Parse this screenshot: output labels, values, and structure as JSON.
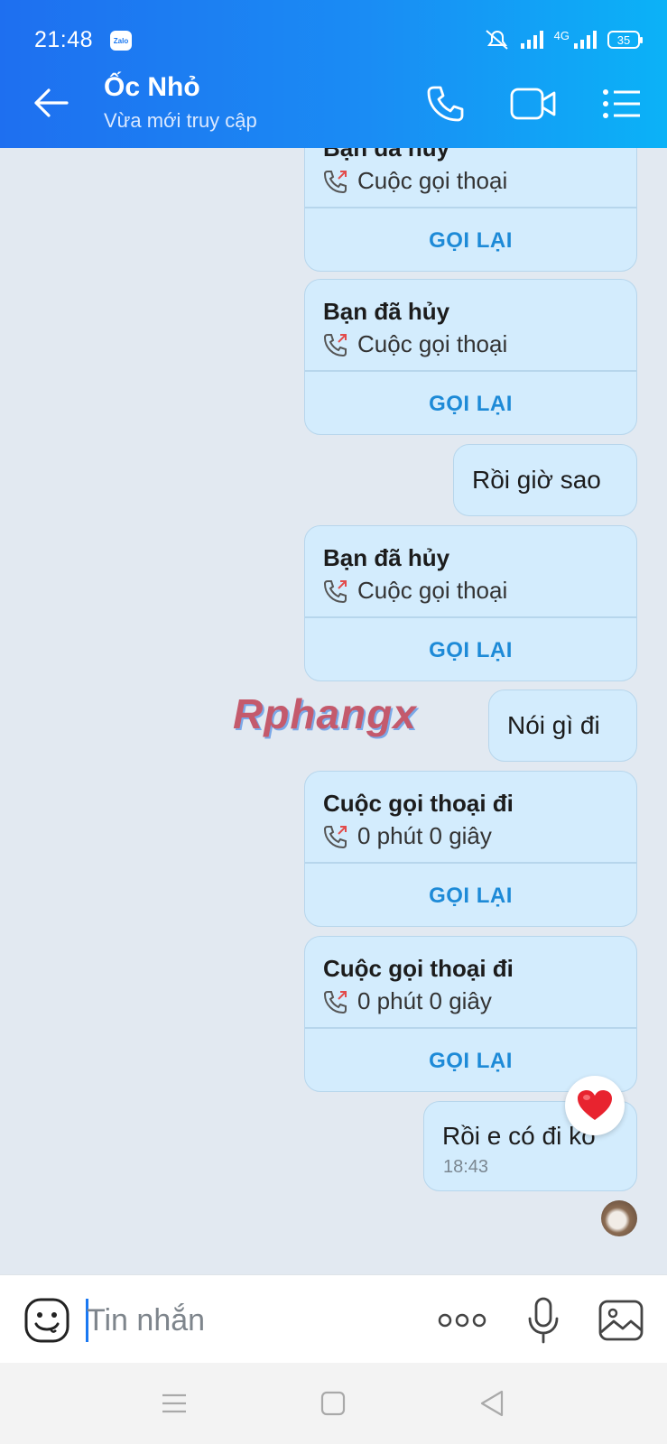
{
  "status_bar": {
    "time": "21:48",
    "app_badge": "Zalo",
    "network": "4G",
    "battery": "35"
  },
  "header": {
    "contact_name": "Ốc Nhỏ",
    "contact_status": "Vừa mới truy cập",
    "icons": [
      "back-arrow-icon",
      "phone-icon",
      "video-call-icon",
      "menu-list-icon"
    ]
  },
  "messages": [
    {
      "type": "call",
      "title": "Bạn đã hủy",
      "subtitle": "Cuộc gọi thoại",
      "action": "GỌI LẠI"
    },
    {
      "type": "call",
      "title": "Bạn đã hủy",
      "subtitle": "Cuộc gọi thoại",
      "action": "GỌI LẠI"
    },
    {
      "type": "text",
      "text": "Rồi giờ sao"
    },
    {
      "type": "call",
      "title": "Bạn đã hủy",
      "subtitle": "Cuộc gọi thoại",
      "action": "GỌI LẠI"
    },
    {
      "type": "text",
      "text": "Nói gì đi"
    },
    {
      "type": "call",
      "title": "Cuộc gọi thoại đi",
      "subtitle": "0 phút 0 giây",
      "action": "GỌI LẠI"
    },
    {
      "type": "call",
      "title": "Cuộc gọi thoại đi",
      "subtitle": "0 phút 0 giây",
      "action": "GỌI LẠI"
    },
    {
      "type": "text",
      "text": "Rồi e có đi ko",
      "time": "18:43",
      "reaction": "heart"
    }
  ],
  "watermark": "Rphangx",
  "input": {
    "placeholder": "Tin nhắn",
    "value": ""
  },
  "colors": {
    "header_start": "#1e6ff0",
    "header_end": "#0bb2f7",
    "bubble": "#d3ecfd",
    "action_text": "#1d8ad7",
    "chat_bg": "#e2e9f1"
  }
}
